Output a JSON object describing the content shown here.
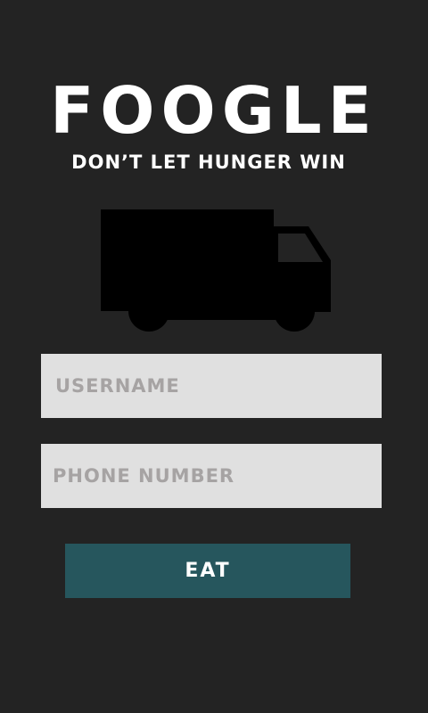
{
  "app": {
    "title": "FOOGLE",
    "tagline": "DON’T LET HUNGER WIN"
  },
  "hero": {
    "icon": "truck-icon"
  },
  "form": {
    "username_placeholder": "USERNAME",
    "username_value": "",
    "phone_placeholder": "PHONE NUMBER",
    "phone_value": "",
    "submit_label": "EAT"
  },
  "colors": {
    "background": "#232323",
    "field_background": "#e0e0e0",
    "placeholder_text": "#a6a3a3",
    "button_background": "#26565d",
    "text": "#ffffff"
  }
}
